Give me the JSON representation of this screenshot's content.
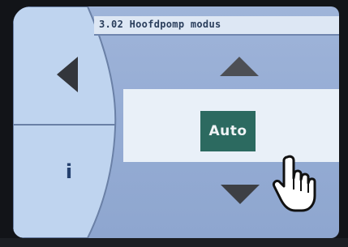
{
  "screen": {
    "title": "3.02 Hoofdpomp modus",
    "value": "Auto",
    "info_label": "i"
  },
  "icons": {
    "back": "triangle-left-icon",
    "up": "arrow-up-icon",
    "down": "arrow-down-icon",
    "cursor": "hand-pointer-icon"
  },
  "colors": {
    "screen_bg": "#9fb4d9",
    "value_band": "#e9f0f8",
    "selected_value_bg": "#2c6a60",
    "arrow": "#4a4a4a",
    "text_dark": "#2a3e5c"
  }
}
